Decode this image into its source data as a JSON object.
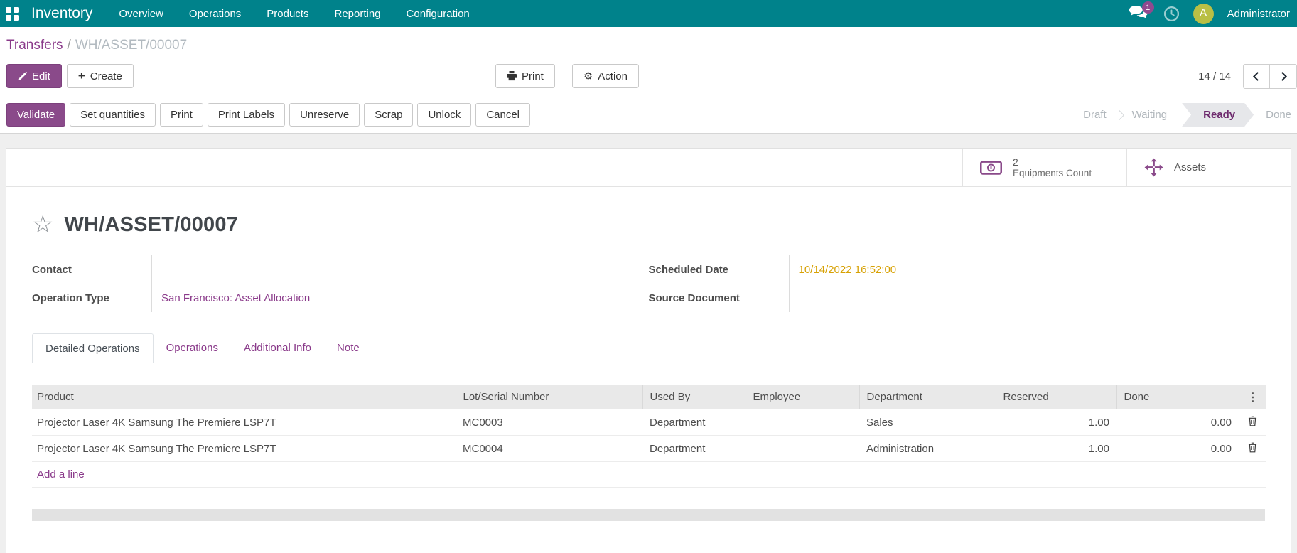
{
  "colors": {
    "navbar_teal": "#00828b",
    "primary_purple": "#8a4a8a",
    "link_purple": "#8a3a8a",
    "ready_state_text": "#6d2a6d",
    "datetime_orange": "#d7a104",
    "badge_purple": "#8f4a8f",
    "avatar_olive": "#b9bf45"
  },
  "nav": {
    "brand": "Inventory",
    "items": [
      "Overview",
      "Operations",
      "Products",
      "Reporting",
      "Configuration"
    ],
    "messages_badge": "1",
    "avatar_initial": "A",
    "user_name": "Administrator"
  },
  "breadcrumb": {
    "parent": "Transfers",
    "separator": "/",
    "current": "WH/ASSET/00007"
  },
  "control_panel": {
    "edit_label": "Edit",
    "create_label": "Create",
    "print_label": "Print",
    "action_label": "Action",
    "pager_text": "14 / 14"
  },
  "statusbar": {
    "primary_button": "Validate",
    "buttons": [
      "Set quantities",
      "Print",
      "Print Labels",
      "Unreserve",
      "Scrap",
      "Unlock",
      "Cancel"
    ],
    "states": {
      "draft": "Draft",
      "waiting": "Waiting",
      "ready": "Ready",
      "done": "Done"
    },
    "active_state": "Ready"
  },
  "smart_buttons": {
    "equipments": {
      "icon": "banknote-icon",
      "value": "2",
      "label": "Equipments Count"
    },
    "assets": {
      "icon": "move-arrows-icon",
      "label": "Assets"
    }
  },
  "sheet": {
    "title": "WH/ASSET/00007",
    "fields": {
      "contact_label": "Contact",
      "contact_value": "",
      "operation_type_label": "Operation Type",
      "operation_type_value": "San Francisco: Asset Allocation",
      "scheduled_date_label": "Scheduled Date",
      "scheduled_date_value": "10/14/2022 16:52:00",
      "source_document_label": "Source Document",
      "source_document_value": ""
    }
  },
  "tabs": [
    "Detailed Operations",
    "Operations",
    "Additional Info",
    "Note"
  ],
  "active_tab": "Detailed Operations",
  "table": {
    "columns": [
      "Product",
      "Lot/Serial Number",
      "Used By",
      "Employee",
      "Department",
      "Reserved",
      "Done"
    ],
    "rows": [
      {
        "product": "Projector Laser 4K Samsung The Premiere LSP7T",
        "lot_serial": "MC0003",
        "used_by": "Department",
        "employee": "",
        "department": "Sales",
        "reserved": "1.00",
        "done": "0.00"
      },
      {
        "product": "Projector Laser 4K Samsung The Premiere LSP7T",
        "lot_serial": "MC0004",
        "used_by": "Department",
        "employee": "",
        "department": "Administration",
        "reserved": "1.00",
        "done": "0.00"
      }
    ],
    "add_line_label": "Add a line"
  }
}
